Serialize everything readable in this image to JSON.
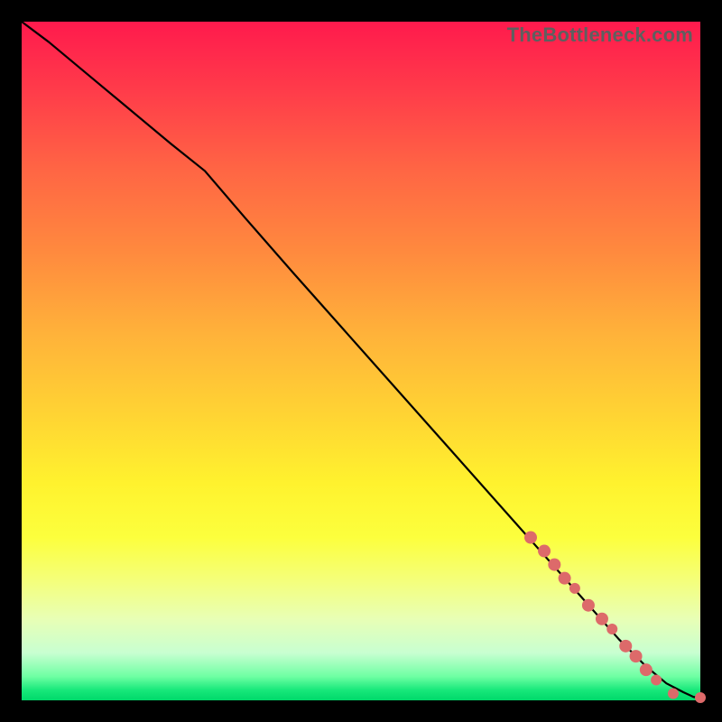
{
  "watermark": "TheBottleneck.com",
  "colors": {
    "marker": "#dd6a6a",
    "curve": "#000000",
    "frame": "#000000"
  },
  "chart_data": {
    "type": "line",
    "title": "",
    "xlabel": "",
    "ylabel": "",
    "xlim": [
      0,
      100
    ],
    "ylim": [
      0,
      100
    ],
    "grid": false,
    "legend": false,
    "series": [
      {
        "name": "curve",
        "x": [
          0,
          4,
          10,
          16,
          22,
          27,
          33,
          40,
          48,
          56,
          64,
          72,
          80,
          88,
          92,
          95,
          97.5,
          99,
          100
        ],
        "y": [
          100,
          97,
          92,
          87,
          82,
          78,
          71,
          63,
          54,
          45,
          36,
          27,
          18,
          9,
          5,
          2.5,
          1.2,
          0.5,
          0.4
        ]
      }
    ],
    "markers": [
      {
        "x": 75,
        "y": 24,
        "r": 7
      },
      {
        "x": 77,
        "y": 22,
        "r": 7
      },
      {
        "x": 78.5,
        "y": 20,
        "r": 7
      },
      {
        "x": 80,
        "y": 18,
        "r": 7
      },
      {
        "x": 81.5,
        "y": 16.5,
        "r": 6
      },
      {
        "x": 83.5,
        "y": 14,
        "r": 7
      },
      {
        "x": 85.5,
        "y": 12,
        "r": 7
      },
      {
        "x": 87,
        "y": 10.5,
        "r": 6
      },
      {
        "x": 89,
        "y": 8,
        "r": 7
      },
      {
        "x": 90.5,
        "y": 6.5,
        "r": 7
      },
      {
        "x": 92,
        "y": 4.5,
        "r": 7
      },
      {
        "x": 93.5,
        "y": 3,
        "r": 6
      },
      {
        "x": 96,
        "y": 1,
        "r": 6
      },
      {
        "x": 100,
        "y": 0.4,
        "r": 6
      }
    ]
  }
}
